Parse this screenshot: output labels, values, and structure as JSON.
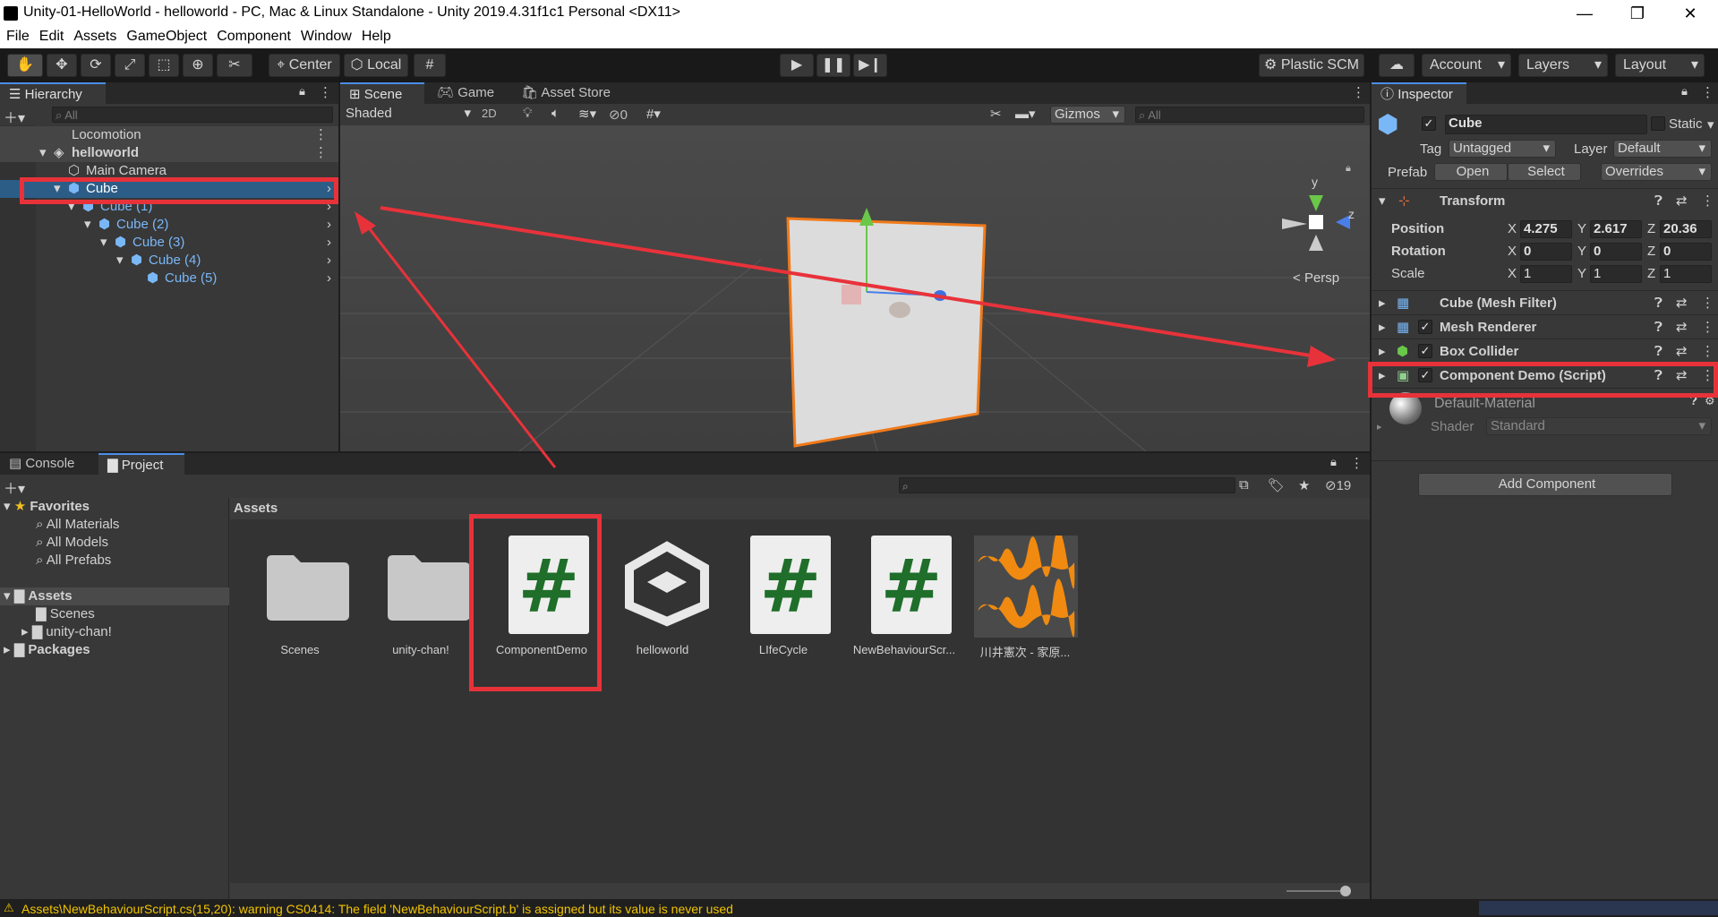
{
  "window": {
    "title": "Unity-01-HelloWorld - helloworld - PC, Mac & Linux Standalone - Unity 2019.4.31f1c1 Personal <DX11>",
    "controls": [
      "—",
      "❐",
      "✕"
    ]
  },
  "menu": [
    "File",
    "Edit",
    "Assets",
    "GameObject",
    "Component",
    "Window",
    "Help"
  ],
  "toolbar": {
    "pivot": "Center",
    "space": "Local",
    "plastic": "Plastic SCM",
    "account": "Account",
    "layers": "Layers",
    "layout": "Layout"
  },
  "hierarchy": {
    "tab": "Hierarchy",
    "search_placeholder": "All",
    "items": [
      {
        "label": "Locomotion"
      },
      {
        "label": "helloworld"
      },
      {
        "label": "Main Camera"
      },
      {
        "label": "Cube"
      },
      {
        "label": "Cube (1)"
      },
      {
        "label": "Cube (2)"
      },
      {
        "label": "Cube (3)"
      },
      {
        "label": "Cube (4)"
      },
      {
        "label": "Cube (5)"
      }
    ]
  },
  "scene": {
    "tabs": [
      "Scene",
      "Game",
      "Asset Store"
    ],
    "shading": "Shaded",
    "mode2d": "2D",
    "fx_count": "0",
    "gizmos": "Gizmos",
    "search_placeholder": "All",
    "persp": "Persp",
    "axis_y": "y",
    "axis_z": "z"
  },
  "project": {
    "tabs": [
      "Console",
      "Project"
    ],
    "hidden_count": "19",
    "favorites": "Favorites",
    "fav_items": [
      "All Materials",
      "All Models",
      "All Prefabs"
    ],
    "tree": [
      {
        "label": "Assets"
      },
      {
        "label": "Scenes"
      },
      {
        "label": "unity-chan!"
      },
      {
        "label": "Packages"
      }
    ],
    "breadcrumb": "Assets",
    "assets": [
      {
        "label": "Scenes",
        "kind": "folder"
      },
      {
        "label": "unity-chan!",
        "kind": "folder"
      },
      {
        "label": "ComponentDemo",
        "kind": "script"
      },
      {
        "label": "helloworld",
        "kind": "scene"
      },
      {
        "label": "LIfeCycle",
        "kind": "script"
      },
      {
        "label": "NewBehaviourScr...",
        "kind": "script"
      },
      {
        "label": "川井憲次 - 家原...",
        "kind": "audio"
      }
    ]
  },
  "inspector": {
    "tab": "Inspector",
    "object_name": "Cube",
    "static_label": "Static",
    "tag_label": "Tag",
    "tag_value": "Untagged",
    "layer_label": "Layer",
    "layer_value": "Default",
    "prefab_label": "Prefab",
    "prefab_open": "Open",
    "prefab_select": "Select",
    "prefab_overrides": "Overrides",
    "transform": {
      "title": "Transform",
      "position_label": "Position",
      "rotation_label": "Rotation",
      "scale_label": "Scale",
      "position": {
        "x": "4.275",
        "y": "2.617",
        "z": "20.36"
      },
      "rotation": {
        "x": "0",
        "y": "0",
        "z": "0"
      },
      "scale": {
        "x": "1",
        "y": "1",
        "z": "1"
      }
    },
    "components": [
      {
        "title": "Cube (Mesh Filter)"
      },
      {
        "title": "Mesh Renderer"
      },
      {
        "title": "Box Collider"
      },
      {
        "title": "Component Demo (Script)"
      }
    ],
    "material": {
      "name": "Default-Material",
      "shader_label": "Shader",
      "shader_value": "Standard"
    },
    "add_component": "Add Component"
  },
  "status": {
    "message": "Assets\\NewBehaviourScript.cs(15,20): warning CS0414: The field 'NewBehaviourScript.b' is assigned but its value is never used"
  },
  "colors": {
    "highlight_box": "#e8323a",
    "selection": "#2c5d87",
    "prefab_blue": "#7ab7f7",
    "warning_yellow": "#f2c400"
  }
}
